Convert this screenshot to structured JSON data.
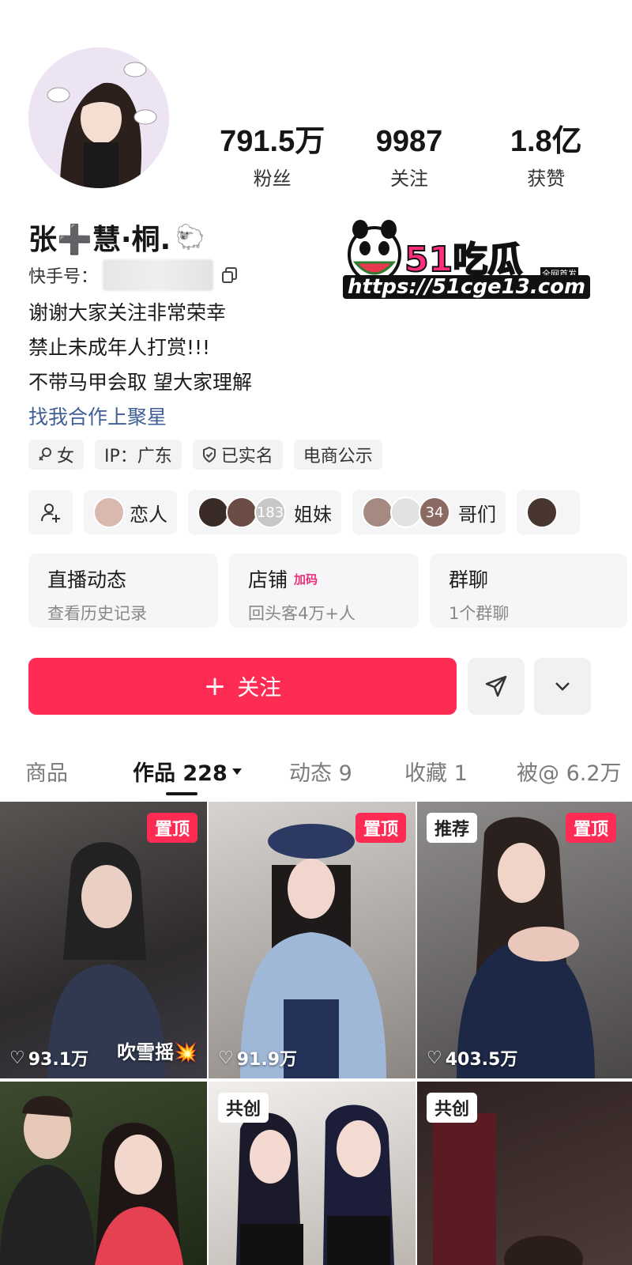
{
  "profile": {
    "name": "张➕慧·桐.",
    "account_label": "快手号：",
    "stats": [
      {
        "value": "791.5万",
        "label": "粉丝"
      },
      {
        "value": "9987",
        "label": "关注"
      },
      {
        "value": "1.8亿",
        "label": "获赞"
      }
    ],
    "bio_lines": [
      "谢谢大家关注非常荣幸",
      "禁止未成年人打赏!!!",
      "不带马甲会取 望大家理解"
    ],
    "bio_link": "找我合作上聚星",
    "tags": [
      {
        "text": "女",
        "icon": "female-icon"
      },
      {
        "text": "IP：广东",
        "icon": ""
      },
      {
        "text": "已实名",
        "icon": "shield-check-icon"
      },
      {
        "text": "电商公示",
        "icon": ""
      }
    ]
  },
  "relations": [
    {
      "label": "恋人"
    },
    {
      "label": "姐妹",
      "count": "183"
    },
    {
      "label": "哥们",
      "count": "34"
    }
  ],
  "cards": [
    {
      "title": "直播动态",
      "sub": "查看历史记录"
    },
    {
      "title": "店铺",
      "badge": "加码",
      "sub": "回头客4万+人"
    },
    {
      "title": "群聊",
      "sub": "1个群聊"
    }
  ],
  "actions": {
    "follow": "关注"
  },
  "tabs": [
    {
      "label": "商品"
    },
    {
      "label": "作品 228",
      "active": true
    },
    {
      "label": "动态 9"
    },
    {
      "label": "收藏 1"
    },
    {
      "label": "被@ 6.2万"
    }
  ],
  "videos": [
    {
      "pill": "置顶",
      "pill_style": "red",
      "likes": "93.1万",
      "caption": "吹雪摇💥"
    },
    {
      "pill": "置顶",
      "pill_style": "red",
      "likes": "91.9万"
    },
    {
      "pill": "推荐",
      "pill_style": "white",
      "pill2": "置顶",
      "likes": "403.5万"
    },
    {},
    {
      "pill": "共创",
      "pill_style": "white"
    },
    {
      "pill": "共创",
      "pill_style": "white"
    }
  ],
  "watermark": {
    "title": "51吃瓜",
    "sub": "全网首发",
    "url": "https://51cge13.com"
  },
  "colors": {
    "accent": "#fe2c55",
    "link": "#3f5f96"
  }
}
